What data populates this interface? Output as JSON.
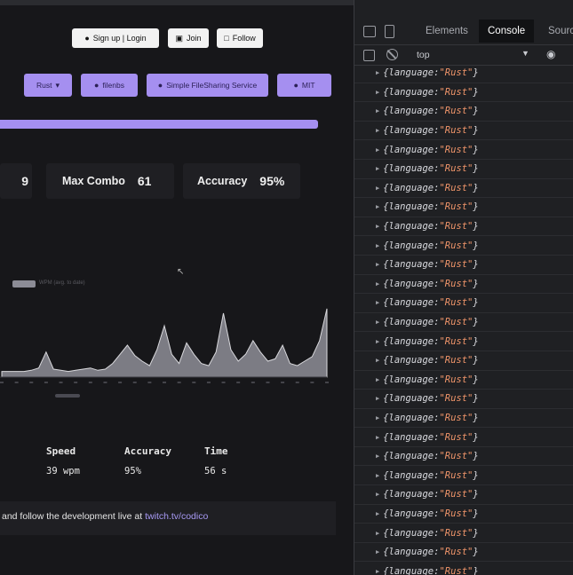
{
  "header": {
    "signup_label": "Sign up | Login",
    "join_label": "Join",
    "follow_label": "Follow"
  },
  "pills": {
    "language": "Rust",
    "repo_owner": "filenbs",
    "repo_name": "Simple FileSharing Service",
    "license": "MIT"
  },
  "progress": {
    "fraction": 1.0
  },
  "stats": {
    "partial_value": "9",
    "max_combo_label": "Max Combo",
    "max_combo_value": "61",
    "accuracy_label": "Accuracy",
    "accuracy_value": "95%"
  },
  "chart_data": {
    "type": "area",
    "legend": [
      "WPM (avg. to date)"
    ],
    "values": [
      5,
      5,
      5,
      5,
      6,
      8,
      22,
      7,
      6,
      5,
      6,
      7,
      8,
      6,
      7,
      12,
      20,
      28,
      19,
      14,
      10,
      24,
      45,
      20,
      12,
      30,
      20,
      12,
      10,
      22,
      56,
      24,
      14,
      20,
      32,
      22,
      14,
      16,
      28,
      12,
      10,
      14,
      18,
      32,
      60
    ],
    "color": "#7c7c84"
  },
  "results": {
    "speed_label": "Speed",
    "speed_value": "39 wpm",
    "accuracy_label": "Accuracy",
    "accuracy_value": "95%",
    "time_label": "Time",
    "time_value": "56 s"
  },
  "footer": {
    "text": "and follow the development live at ",
    "link": "twitch.tv/codico"
  },
  "devtools": {
    "tab_elements": "Elements",
    "tab_console": "Console",
    "tab_sources": "Sourc",
    "context": "top",
    "log_prefix": "{language: ",
    "log_value": "\"Rust\"",
    "log_suffix": "}",
    "log_count": 27
  },
  "colors": {
    "accent": "#a58ff0",
    "link": "#a89af5",
    "console_string": "#f0956a"
  }
}
